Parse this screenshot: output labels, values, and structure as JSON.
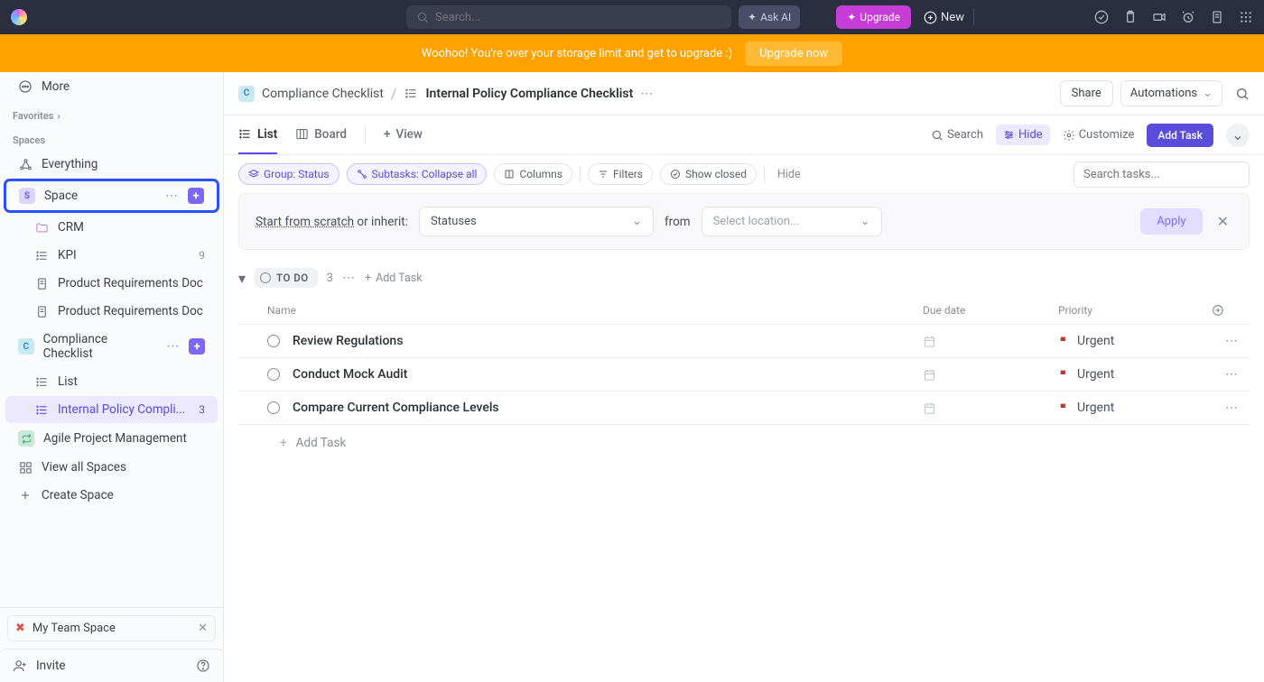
{
  "top": {
    "search_placeholder": "Search...",
    "ask_ai": "Ask AI",
    "upgrade": "Upgrade",
    "new": "New"
  },
  "banner": {
    "text": "Woohoo! You're over your storage limit and get to upgrade :)",
    "button": "Upgrade now"
  },
  "sidebar": {
    "more": "More",
    "favorites": "Favorites",
    "spaces": "Spaces",
    "everything": "Everything",
    "space": {
      "label": "Space",
      "badge": "S"
    },
    "items": {
      "crm": "CRM",
      "kpi": "KPI",
      "kpi_count": "9",
      "prd1": "Product Requirements Doc",
      "prd2": "Product Requirements Doc",
      "cc": "Compliance Checklist",
      "cc_badge": "C",
      "list": "List",
      "policy": "Internal Policy Compli...",
      "policy_count": "3",
      "apm": "Agile Project Management",
      "view_all": "View all Spaces",
      "create": "Create Space"
    },
    "team_space": "My Team Space",
    "invite": "Invite"
  },
  "crumb": {
    "badge": "C",
    "parent": "Compliance Checklist",
    "current": "Internal Policy Compliance Checklist",
    "share": "Share",
    "automations": "Automations"
  },
  "views": {
    "list": "List",
    "board": "Board",
    "view": "View",
    "search": "Search",
    "hide": "Hide",
    "customize": "Customize",
    "add_task": "Add Task"
  },
  "chips": {
    "group": "Group: Status",
    "subtasks": "Subtasks: Collapse all",
    "columns": "Columns",
    "filters": "Filters",
    "show_closed": "Show closed",
    "hide": "Hide",
    "search_placeholder": "Search tasks..."
  },
  "inherit": {
    "prefix": "Start from scratch",
    "suffix": " or inherit:",
    "statuses": "Statuses",
    "from": "from",
    "location_placeholder": "Select location...",
    "apply": "Apply"
  },
  "group": {
    "status": "TO DO",
    "count": "3",
    "add_task": "Add Task"
  },
  "cols": {
    "name": "Name",
    "due": "Due date",
    "priority": "Priority"
  },
  "tasks": [
    {
      "name": "Review Regulations",
      "priority": "Urgent"
    },
    {
      "name": "Conduct Mock Audit",
      "priority": "Urgent"
    },
    {
      "name": "Compare Current Compliance Levels",
      "priority": "Urgent"
    }
  ],
  "add_task_row": "Add Task"
}
